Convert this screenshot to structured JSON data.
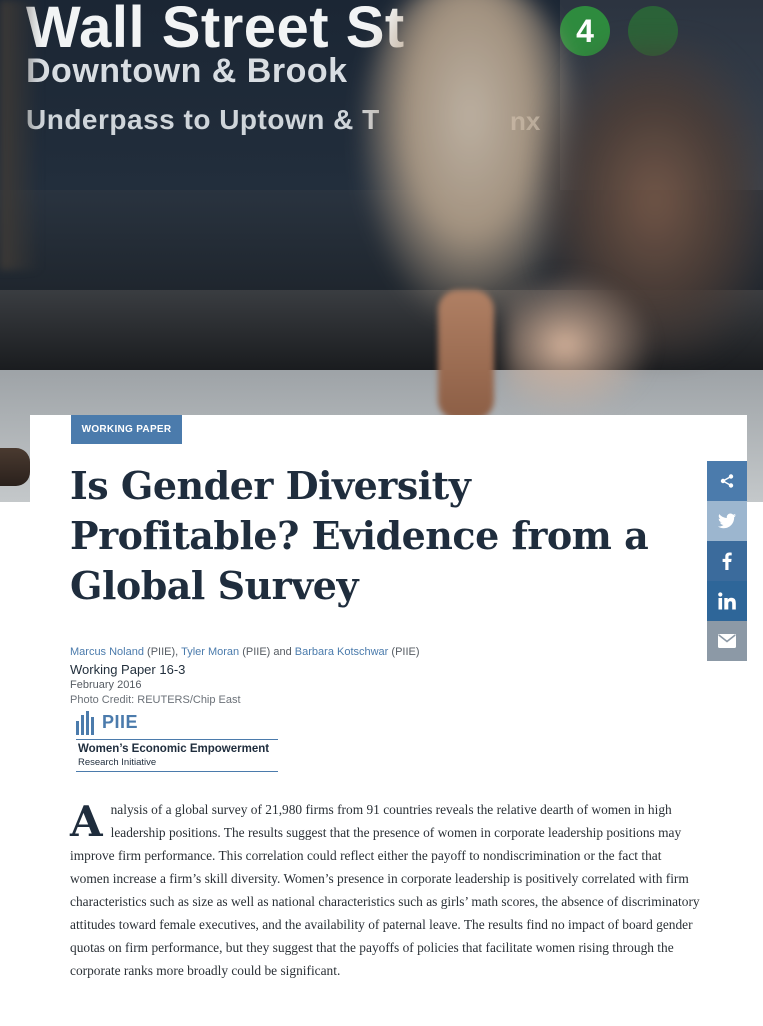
{
  "hero": {
    "sign_line_1": "Wall Street St",
    "sign_line_2": "Downtown & Brook",
    "sign_line_3": "Underpass to Uptown & T",
    "sign_line_3_tail": "nx",
    "route_number": "4"
  },
  "article": {
    "category": "WORKING PAPER",
    "title": "Is Gender Diversity Profitable? Evidence from a Global Survey",
    "authors": [
      {
        "name": "Marcus Noland",
        "affiliation": " (PIIE), "
      },
      {
        "name": "Tyler Moran",
        "affiliation": " (PIIE) and "
      },
      {
        "name": "Barbara Kotschwar",
        "affiliation": " (PIIE)"
      }
    ],
    "paper_number": "Working Paper 16-3",
    "date": "February 2016",
    "photo_credit": "Photo Credit: REUTERS/Chip East",
    "abstract_dropcap": "A",
    "abstract_body": "nalysis of a global survey of 21,980 firms from 91 countries reveals the relative dearth of women in high leadership positions. The results suggest that the presence of women in corporate leadership positions may improve firm performance. This correlation could reflect either the payoff to nondiscrimination or the fact that women increase a firm’s skill diversity. Women’s presence in corporate leadership is positively correlated with firm characteristics such as size as well as national characteristics such as girls’ math scores, the absence of discriminatory attitudes toward female executives, and the availability of paternal leave. The results find no impact of board gender quotas on firm performance, but they suggest that the payoffs of policies that facilitate women rising through the corporate ranks more broadly could be significant."
  },
  "logo": {
    "brand": "PIIE",
    "line1": "Women’s Economic Empowerment",
    "line2": "Research Initiative"
  },
  "share_bar": {
    "icons": [
      "share-icon",
      "twitter-icon",
      "facebook-icon",
      "linkedin-icon",
      "email-icon"
    ],
    "colors": {
      "share": "#4b7bac",
      "twitter": "#9cb6cf",
      "facebook": "#3b6b9c",
      "linkedin": "#2e6699",
      "email": "#8c99a6"
    }
  },
  "colors": {
    "accent": "#4b7bac",
    "title": "#1f2d3d"
  }
}
